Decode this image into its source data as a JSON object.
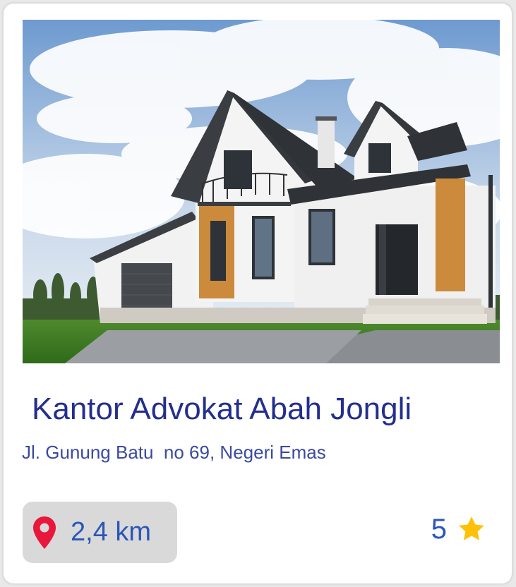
{
  "listing": {
    "title": " Kantor Advokat Abah Jongli",
    "address": "Jl. Gunung Batu  no 69, Negeri Emas",
    "image": "house-photo",
    "distance": {
      "icon": "map-pin-icon",
      "value": "2,4 km"
    },
    "rating": {
      "value": "5",
      "icon": "star-icon"
    }
  },
  "colors": {
    "title": "#232e8f",
    "address": "#3a4aa0",
    "accent": "#2a56b8",
    "pin": "#e8173c",
    "star": "#ffc107",
    "chip_bg": "#d9d9d9"
  }
}
